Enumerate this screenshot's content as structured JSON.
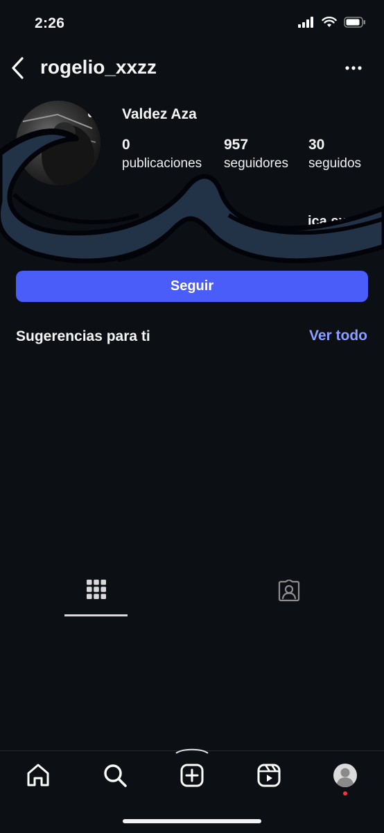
{
  "status_bar": {
    "time": "2:26"
  },
  "header": {
    "username": "rogelio_xxzz"
  },
  "profile": {
    "display_name": "Valdez Aza",
    "stats": [
      {
        "value": "0",
        "label": "publicaciones"
      },
      {
        "value": "957",
        "label": "seguidores"
      },
      {
        "value": "30",
        "label": "seguidos"
      }
    ],
    "partial_text": "ica sx"
  },
  "actions": {
    "follow_label": "Seguir"
  },
  "suggestions": {
    "title": "Sugerencias para ti",
    "see_all": "Ver todo"
  },
  "colors": {
    "background": "#0c1014",
    "accent": "#4a5df9",
    "link": "#8c9eff",
    "notification": "#ff3040"
  },
  "tabs": [
    {
      "icon": "grid-icon",
      "active": true
    },
    {
      "icon": "tagged-icon",
      "active": false
    }
  ],
  "nav": [
    "home-icon",
    "search-icon",
    "create-icon",
    "reels-icon",
    "profile-icon"
  ]
}
